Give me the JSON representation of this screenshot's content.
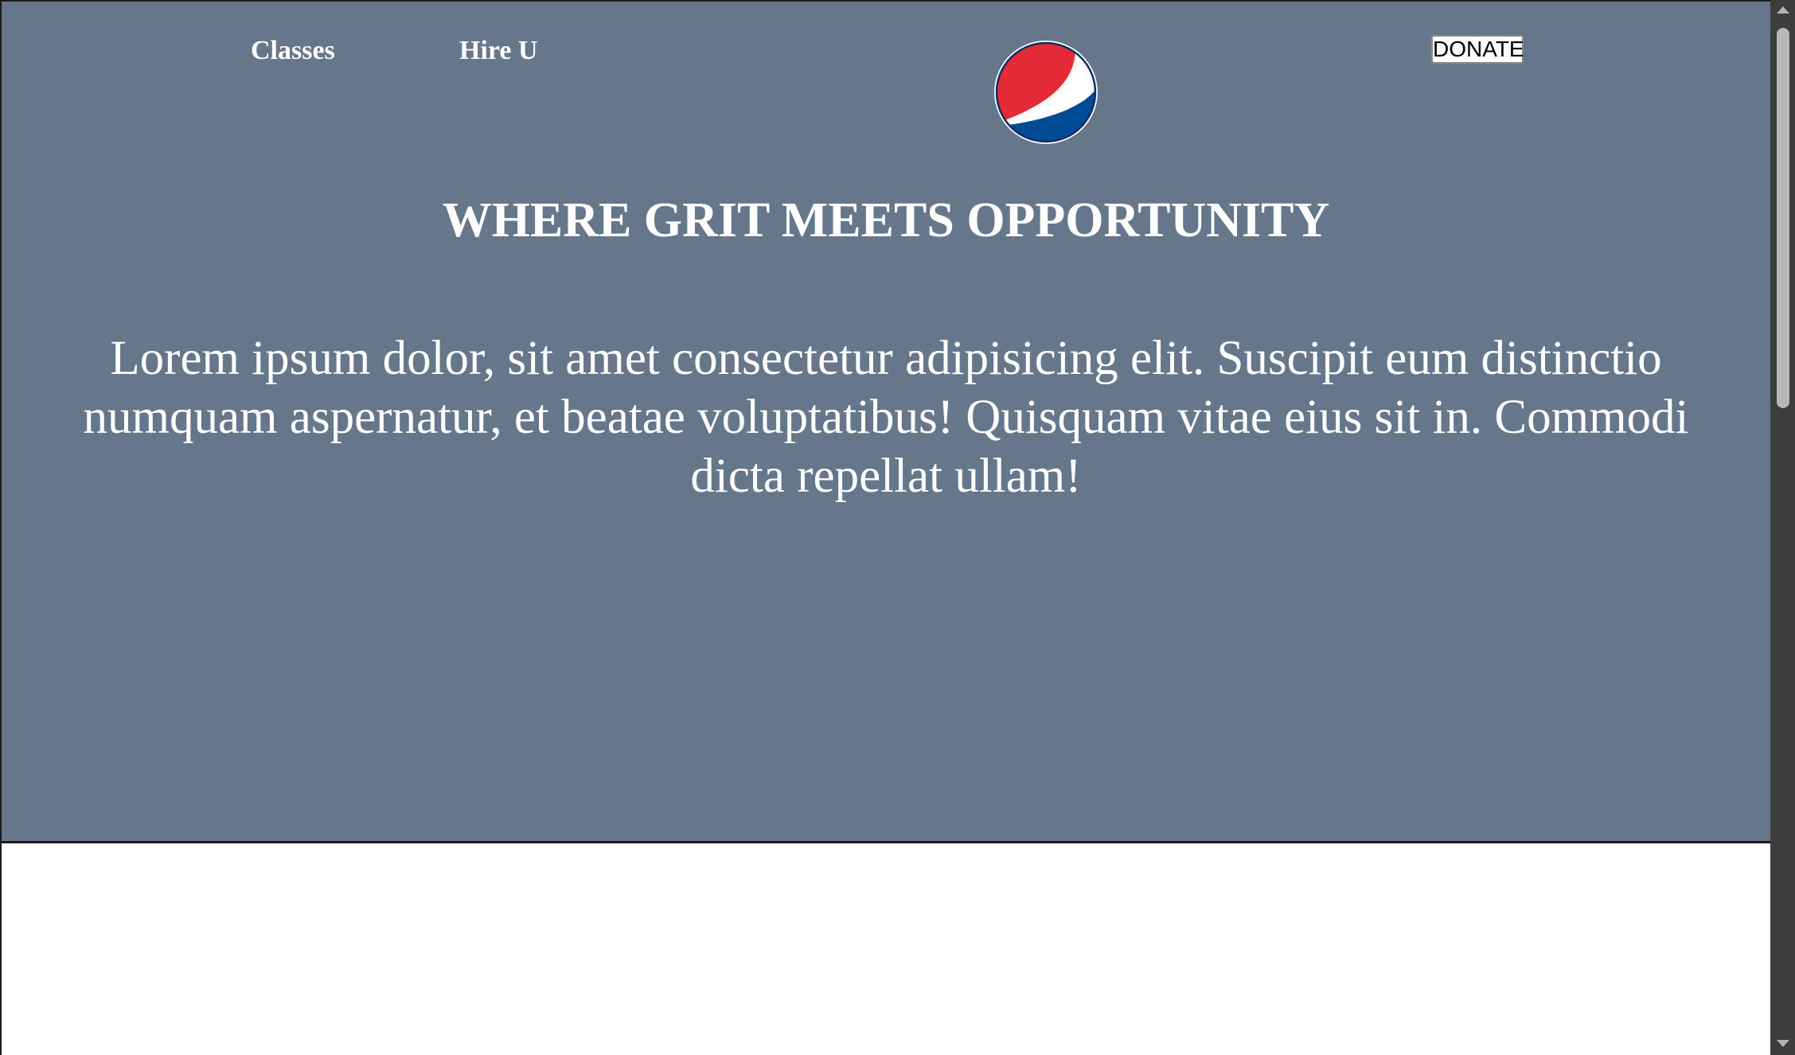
{
  "nav": {
    "links": [
      {
        "label": "Classes"
      },
      {
        "label": "Hire U"
      }
    ],
    "donate_label": "DONATE"
  },
  "logo": {
    "icon": "pepsi-globe-logo",
    "colors": {
      "red": "#e42a37",
      "white": "#ffffff",
      "blue": "#004b93"
    }
  },
  "hero": {
    "background_color": "#66768b",
    "headline": "WHERE GRIT MEETS OPPORTUNITY",
    "paragraph": "Lorem ipsum dolor, sit amet consectetur adipisicing elit. Suscipit eum distinctio numquam aspernatur, et beatae voluptatibus! Quisquam vitae eius sit in. Commodi dicta repellat ullam!"
  }
}
